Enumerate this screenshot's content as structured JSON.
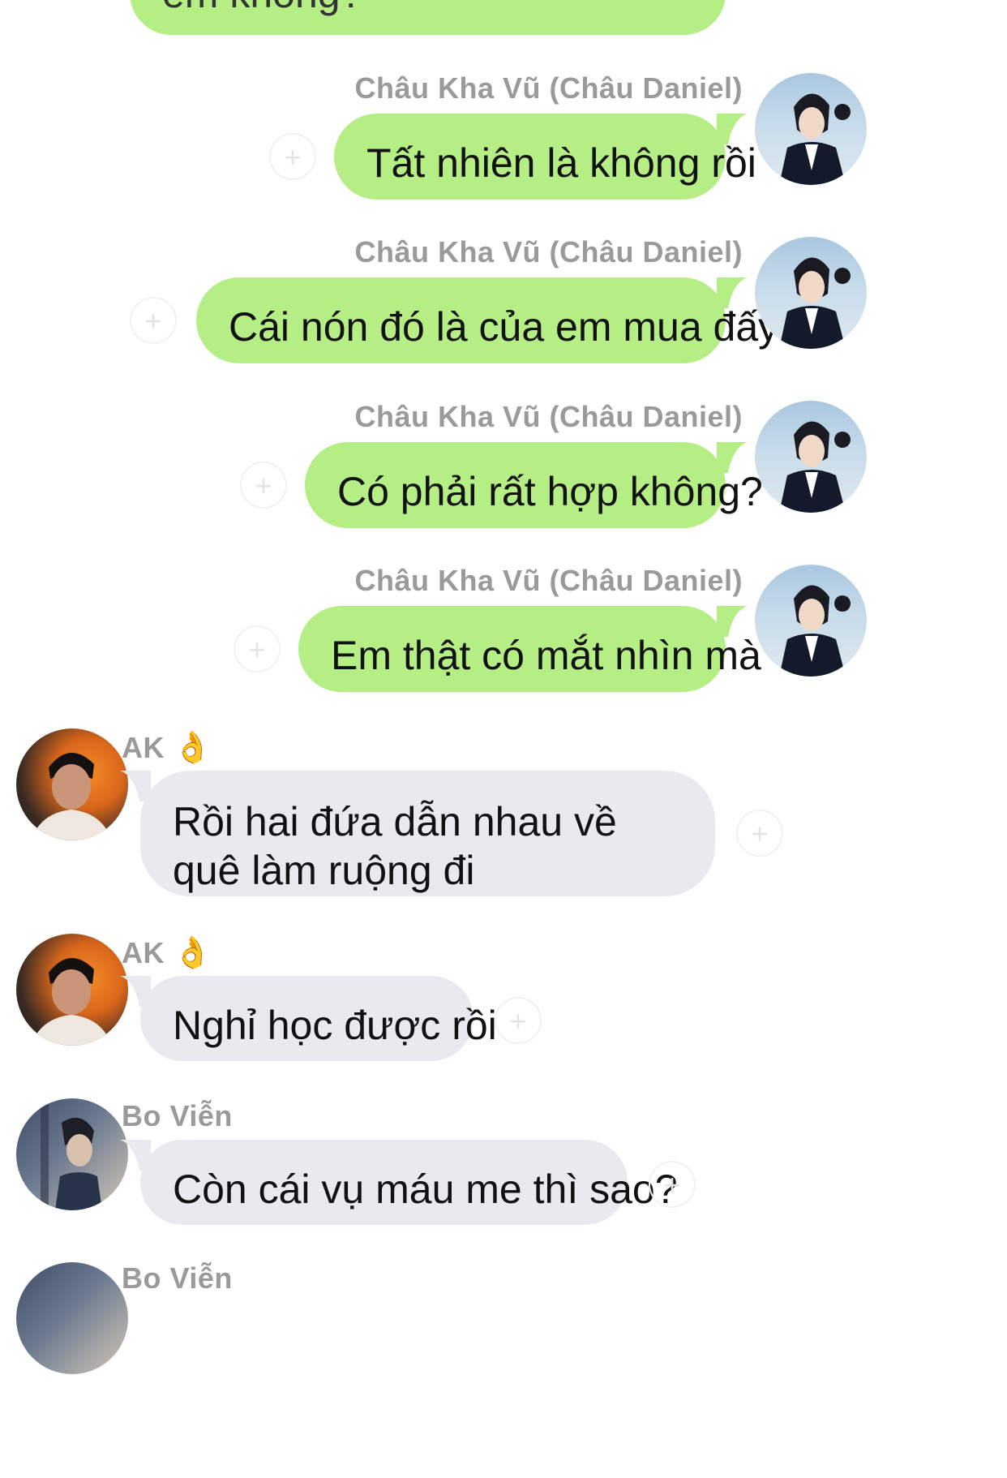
{
  "colors": {
    "outgoing": "#b5ee84",
    "incoming": "#e9eaee",
    "sender_name": "#9a9a9a"
  },
  "top_fragment": "em không?",
  "outgoing": [
    {
      "sender": "Châu Kha Vũ (Châu Daniel)",
      "text": "Tất nhiên là không rồi"
    },
    {
      "sender": "Châu Kha Vũ (Châu Daniel)",
      "text": "Cái nón đó là của em mua đấy"
    },
    {
      "sender": "Châu Kha Vũ (Châu Daniel)",
      "text": "Có phải rất hợp không?"
    },
    {
      "sender": "Châu Kha Vũ (Châu Daniel)",
      "text": "Em thật có mắt nhìn mà"
    }
  ],
  "incoming": [
    {
      "sender": "AK",
      "badge": "👌",
      "text": "Rồi hai đứa dẫn nhau về quê làm ruộng đi"
    },
    {
      "sender": "AK",
      "badge": "👌",
      "text": "Nghỉ học được rồi"
    },
    {
      "sender": "Bo Viễn",
      "text": "Còn cái vụ máu me thì sao?"
    }
  ],
  "bottom_fragment_sender": "Bo Viễn",
  "icons": {
    "reaction": "add-reaction-icon"
  }
}
